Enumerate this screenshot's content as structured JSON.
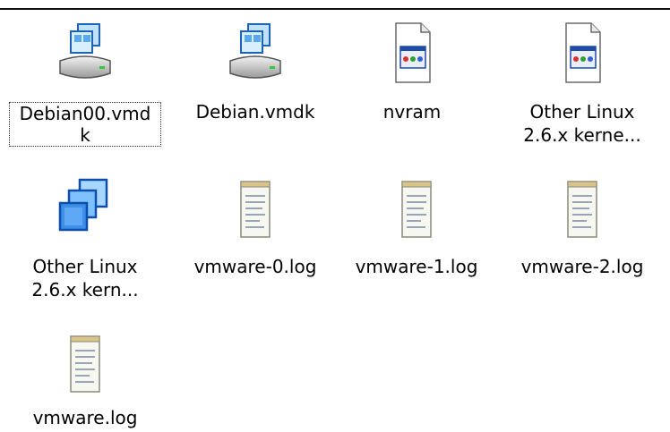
{
  "files": [
    {
      "name": "Debian00.vmd\nk",
      "icon": "vmdk-disk-icon",
      "selected": true
    },
    {
      "name": "Debian.vmdk",
      "icon": "vmdk-disk-icon",
      "selected": false
    },
    {
      "name": "nvram",
      "icon": "nvram-file-icon",
      "selected": false
    },
    {
      "name": "Other Linux\n2.6.x kerne...",
      "icon": "nvram-file-icon",
      "selected": false
    },
    {
      "name": "Other Linux\n2.6.x kern...",
      "icon": "vmware-vmx-icon",
      "selected": false
    },
    {
      "name": "vmware-0.log",
      "icon": "log-notepad-icon",
      "selected": false
    },
    {
      "name": "vmware-1.log",
      "icon": "log-notepad-icon",
      "selected": false
    },
    {
      "name": "vmware-2.log",
      "icon": "log-notepad-icon",
      "selected": false
    },
    {
      "name": "vmware.log",
      "icon": "log-notepad-icon",
      "selected": false
    }
  ]
}
